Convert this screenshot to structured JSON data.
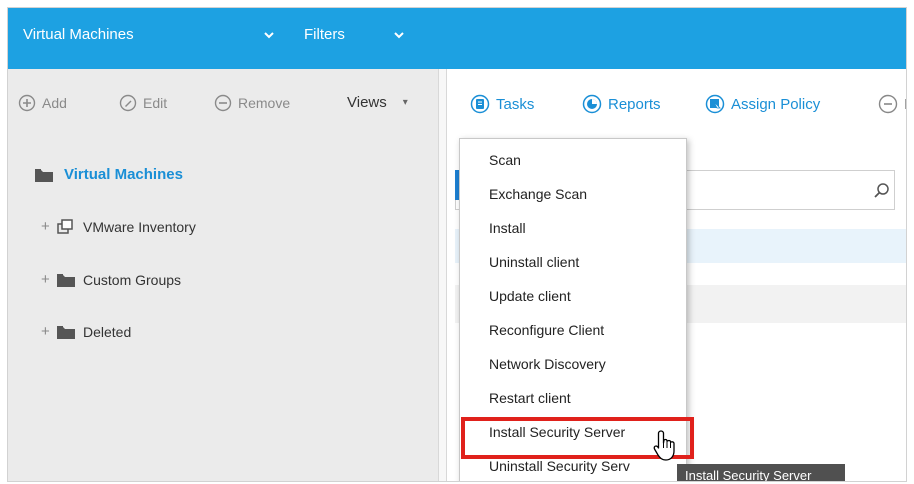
{
  "topbar": {
    "section_label": "Virtual Machines",
    "filters_label": "Filters",
    "bg_color": "#1da1e2"
  },
  "left_toolbar": {
    "add_label": "Add",
    "edit_label": "Edit",
    "remove_label": "Remove",
    "views_label": "Views",
    "views_caret": "▾"
  },
  "tree": {
    "root": {
      "label": "Virtual Machines",
      "icon": "folder-icon"
    },
    "items": [
      {
        "expander": "+",
        "label": "VMware Inventory",
        "icon": "vmware-inventory-icon"
      },
      {
        "expander": "+",
        "label": "Custom Groups",
        "icon": "folder-icon"
      },
      {
        "expander": "+",
        "label": "Deleted",
        "icon": "folder-icon"
      }
    ]
  },
  "right_toolbar": {
    "tasks_label": "Tasks",
    "reports_label": "Reports",
    "assign_policy_label": "Assign Policy",
    "truncated_label": "D",
    "accent_color": "#1a8fd6"
  },
  "tasks_menu": {
    "items": [
      "Scan",
      "Exchange Scan",
      "Install",
      "Uninstall client",
      "Update client",
      "Reconfigure Client",
      "Network Discovery",
      "Restart client",
      "Install Security Server",
      "Uninstall Security Serv"
    ],
    "highlight_color": "#e0211b"
  },
  "tooltip": {
    "text": "Install Security Server"
  }
}
